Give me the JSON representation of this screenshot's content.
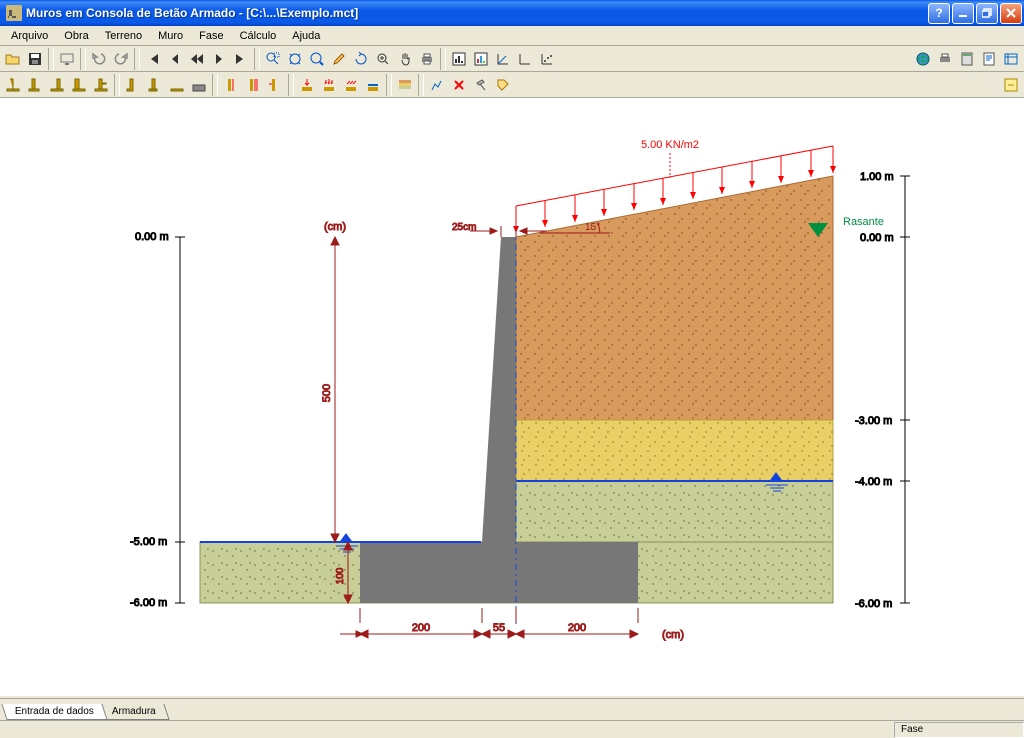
{
  "window": {
    "title": "Muros em Consola de Betão Armado - [C:\\...\\Exemplo.mct]"
  },
  "menu": {
    "items": [
      "Arquivo",
      "Obra",
      "Terreno",
      "Muro",
      "Fase",
      "Cálculo",
      "Ajuda"
    ]
  },
  "tabs": {
    "active": "Entrada de dados",
    "items": [
      {
        "label": "Entrada de dados"
      },
      {
        "label": "Armadura"
      }
    ]
  },
  "status": {
    "phase_label": "Fase"
  },
  "diagram": {
    "load_label": "5.00 KN/m2",
    "rasante_label": "Rasante",
    "top_width_label": "25cm",
    "angle_label": "15°",
    "cm_unit": "(cm)",
    "height_dim_cm": "500",
    "foot_thickness_cm": "100",
    "base_dims": {
      "left": "200",
      "mid": "55",
      "right": "200",
      "unit": "(cm)"
    },
    "left_axis": {
      "top": "0.00 m",
      "m5": "-5.00 m",
      "m6": "-6.00 m"
    },
    "right_axis": {
      "p1": "1.00 m",
      "p0": "0.00 m",
      "m3": "-3.00 m",
      "m4": "-4.00 m",
      "m6": "-6.00 m"
    }
  },
  "colors": {
    "soil1": "#d89a5d",
    "soil1_b": "#a86b35",
    "soil2": "#e9cf66",
    "soil2_b": "#b8a137",
    "soil3": "#c8ce97",
    "soil3_b": "#8e9358",
    "concrete": "#777777",
    "dim": "#9c1b1b",
    "water": "#1144dd",
    "load": "red",
    "rasante": "#009040"
  }
}
